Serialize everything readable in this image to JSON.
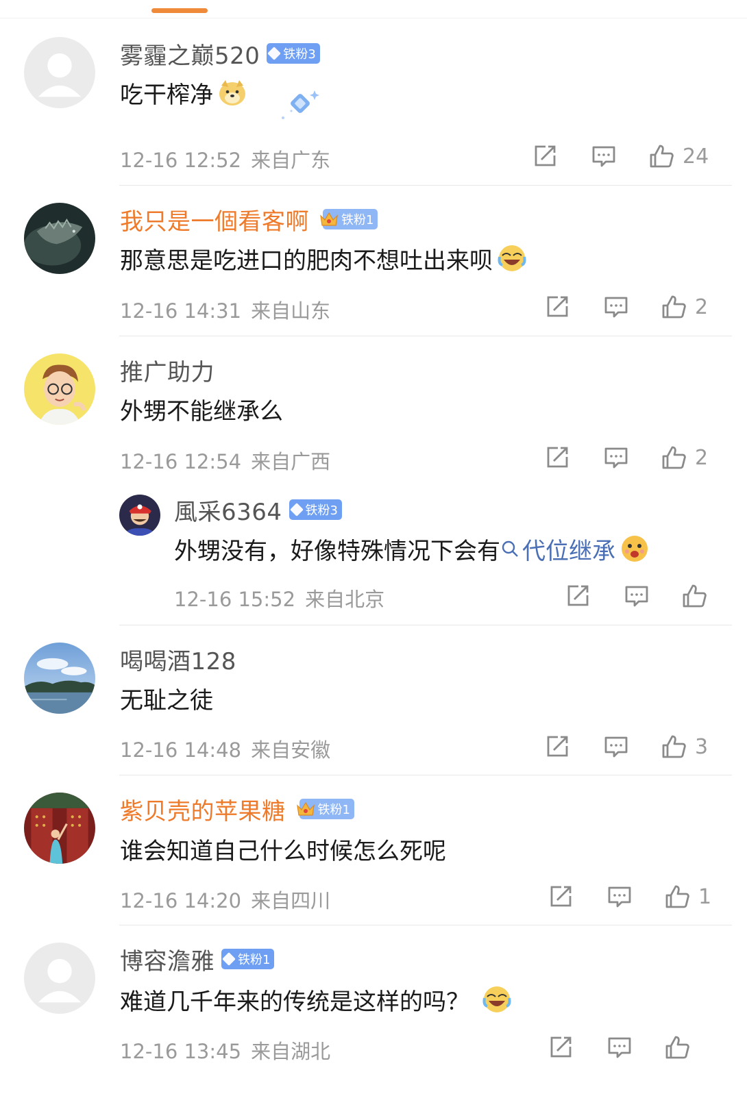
{
  "comments": [
    {
      "name": "雾霾之巅520",
      "badge": "铁粉3",
      "text": "吃干榨净",
      "time": "12-16 12:52",
      "from": "来自广东",
      "likes": "24"
    },
    {
      "name": "我只是一個看客啊",
      "badge": "铁粉1",
      "text": "那意思是吃进口的肥肉不想吐出来呗",
      "time": "12-16 14:31",
      "from": "来自山东",
      "likes": "2"
    },
    {
      "name": "推广助力",
      "text": "外甥不能继承么",
      "time": "12-16 12:54",
      "from": "来自广西",
      "likes": "2"
    },
    {
      "name": "風采6364",
      "badge": "铁粉3",
      "text": "外甥没有，好像特殊情况下会有",
      "link": "代位继承",
      "time": "12-16 15:52",
      "from": "来自北京",
      "likes": ""
    },
    {
      "name": "喝喝酒128",
      "text": "无耻之徒",
      "time": "12-16 14:48",
      "from": "来自安徽",
      "likes": "3"
    },
    {
      "name": "紫贝壳的苹果糖",
      "badge": "铁粉1",
      "text": "谁会知道自己什么时候怎么死呢",
      "time": "12-16 14:20",
      "from": "来自四川",
      "likes": "1"
    },
    {
      "name": "博容澹雅",
      "badge": "铁粉1",
      "text": "难道几千年来的传统是这样的吗？",
      "time": "12-16 13:45",
      "from": "来自湖北",
      "likes": ""
    }
  ],
  "colors": {
    "accent": "#ee7b2b",
    "badge_blue": "#6f9ff2",
    "link": "#4a6fb5",
    "meta": "#9a9a9a"
  },
  "icons": [
    "share-icon",
    "comment-icon",
    "like-icon",
    "search-link-icon",
    "emoji-icon",
    "crown-icon",
    "gem-icon"
  ]
}
